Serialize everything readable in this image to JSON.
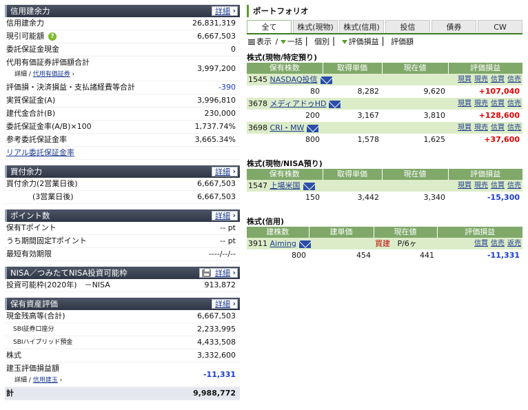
{
  "credit_margin": {
    "title": "信用建余力",
    "more": "詳細",
    "rows": [
      {
        "label": "信用建余力",
        "value": "26,831,319"
      },
      {
        "label": "現引可能額",
        "value": "6,667,503"
      },
      {
        "label": "委託保証金現金",
        "value": "0"
      },
      {
        "label": "代用有価証券評価額合計",
        "sub_label": "詳細",
        "sub_link": "代用有価証券",
        "value": "3,997,200"
      },
      {
        "label": "評価損・決済損益・支払諸経費等合計",
        "value": "-390"
      },
      {
        "label": "実質保証金(A)",
        "value": "3,996,810"
      },
      {
        "label": "建代金合計(B)",
        "value": "230,000"
      },
      {
        "label": "委託保証金率(A/B)×100",
        "value": "1,737.74%"
      },
      {
        "label": "参考委託保証金率",
        "value": "3,665.34%"
      }
    ],
    "link": "リアル委託保証金率"
  },
  "buying_power": {
    "title": "買付余力",
    "more": "詳細",
    "rows": [
      {
        "label": "買付余力(2営業日後)",
        "value": "6,667,503"
      },
      {
        "label": "(3営業日後)",
        "value": "6,667,503"
      }
    ]
  },
  "points": {
    "title": "ポイント数",
    "more": "詳細",
    "rows": [
      {
        "label": "保有Tポイント",
        "value": "-- pt"
      },
      {
        "label": "うち期間固定Tポイント",
        "value": "-- pt"
      },
      {
        "label": "最短有効期限",
        "value": "----/--/--"
      }
    ]
  },
  "nisa": {
    "title": "NISA／つみたてNISA投資可能枠",
    "more": "詳細",
    "rows": [
      {
        "label": "投資可能枠(2020年)　－NISA",
        "value": "913,872"
      }
    ]
  },
  "assets": {
    "title": "保有資産評価",
    "more": "詳細",
    "rows": [
      {
        "label": "現金残高等(合計)",
        "value": "6,667,503"
      },
      {
        "label": "SBI証券口座分",
        "value": "2,233,995"
      },
      {
        "label": "SBIハイブリッド預金",
        "value": "4,433,508"
      },
      {
        "label": "株式",
        "value": "3,332,600"
      },
      {
        "label": "建玉評価損益額",
        "sub_label": "詳細",
        "sub_link": "信用建玉",
        "value": "-11,331"
      },
      {
        "label": "計",
        "value": "9,988,772"
      }
    ]
  },
  "portfolio": {
    "title": "ポートフォリオ",
    "tabs": [
      "全て",
      "株式(現物)",
      "株式(信用)",
      "投信",
      "債券",
      "CW"
    ],
    "view_options": [
      "表示",
      "一括",
      "個別",
      "評価損益",
      "評価額"
    ],
    "sections": [
      {
        "title": "株式(現物/特定預り)",
        "headers": [
          "保有株数",
          "取得単価",
          "現在値",
          "評価損益"
        ],
        "holdings": [
          {
            "code": "1545",
            "name": "NASDAQ投信",
            "qty": "80",
            "cost": "8,282",
            "price": "9,620",
            "pl": "+107,040"
          },
          {
            "code": "3678",
            "name": "メディアドゥHD",
            "qty": "200",
            "cost": "3,167",
            "price": "3,810",
            "pl": "+128,600"
          },
          {
            "code": "3698",
            "name": "CRI・MW",
            "qty": "800",
            "cost": "1,578",
            "price": "1,625",
            "pl": "+37,600"
          }
        ],
        "actions": [
          "現買",
          "現売",
          "信買",
          "信売"
        ]
      },
      {
        "title": "株式(現物/NISA預り)",
        "headers": [
          "保有株数",
          "取得単価",
          "現在値",
          "評価損益"
        ],
        "holdings": [
          {
            "code": "1547",
            "name": "上場米国",
            "qty": "150",
            "cost": "3,442",
            "price": "3,340",
            "pl": "-15,300"
          }
        ],
        "actions": [
          "現買",
          "現売",
          "信買",
          "信売"
        ]
      },
      {
        "title": "株式(信用)",
        "headers": [
          "建株数",
          "建単価",
          "現在値",
          "評価損益"
        ],
        "holdings": [
          {
            "code": "3911",
            "name": "Aiming",
            "type": "買建",
            "term": "P/6ヶ",
            "qty": "800",
            "cost": "454",
            "price": "441",
            "pl": "-11,331"
          }
        ],
        "actions": [
          "信買",
          "信売",
          "返売"
        ]
      }
    ]
  }
}
